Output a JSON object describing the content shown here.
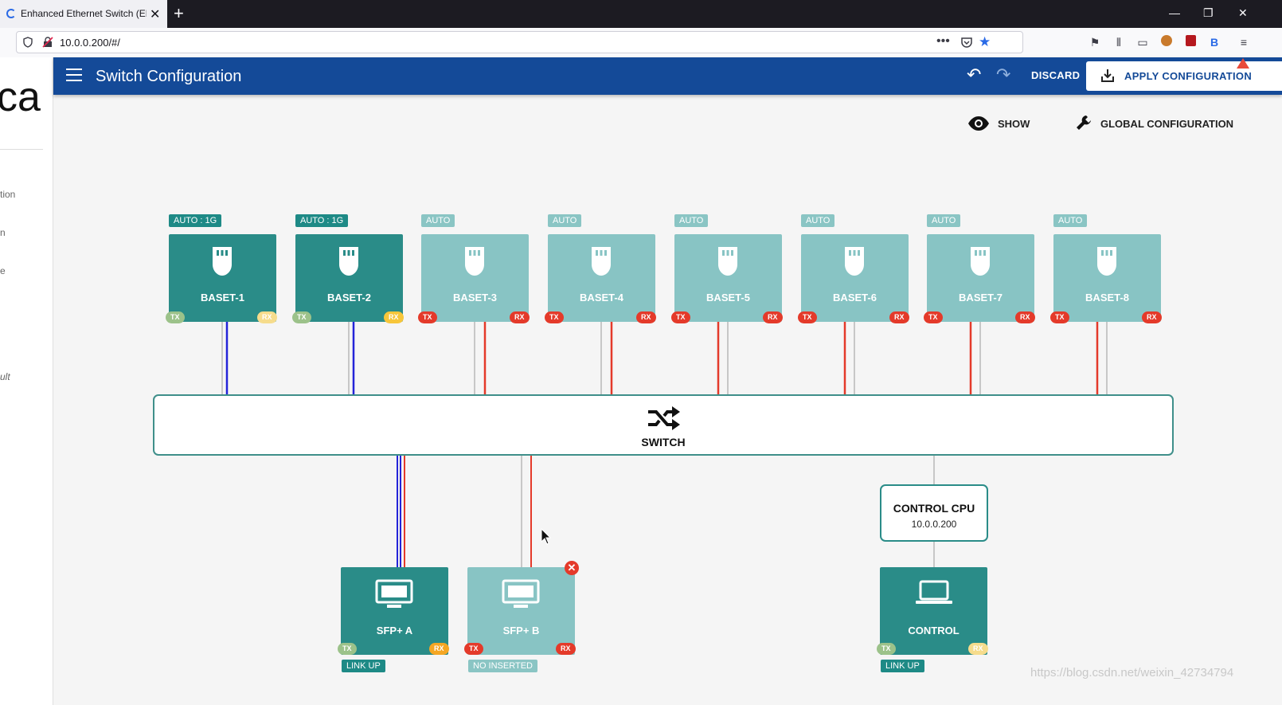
{
  "browser": {
    "tab_title": "Enhanced Ethernet Switch (EES",
    "url": "10.0.0.200/#/"
  },
  "sidebar": {
    "logo_text": "ca",
    "items": [
      "tion",
      "n",
      "e",
      "ult"
    ]
  },
  "appbar": {
    "title": "Switch Configuration",
    "discard_label": "DISCARD",
    "apply_label": "APPLY CONFIGURATION"
  },
  "toolbar": {
    "show_label": "SHOW",
    "global_label": "GLOBAL CONFIGURATION"
  },
  "ports": [
    {
      "name": "BASET-1",
      "tag": "AUTO : 1G",
      "active": true,
      "tx": "TX",
      "rx": "RX"
    },
    {
      "name": "BASET-2",
      "tag": "AUTO : 1G",
      "active": true,
      "tx": "TX",
      "rx": "RX"
    },
    {
      "name": "BASET-3",
      "tag": "AUTO",
      "active": false,
      "tx": "TX",
      "rx": "RX"
    },
    {
      "name": "BASET-4",
      "tag": "AUTO",
      "active": false,
      "tx": "TX",
      "rx": "RX"
    },
    {
      "name": "BASET-5",
      "tag": "AUTO",
      "active": false,
      "tx": "TX",
      "rx": "RX"
    },
    {
      "name": "BASET-6",
      "tag": "AUTO",
      "active": false,
      "tx": "TX",
      "rx": "RX"
    },
    {
      "name": "BASET-7",
      "tag": "AUTO",
      "active": false,
      "tx": "TX",
      "rx": "RX"
    },
    {
      "name": "BASET-8",
      "tag": "AUTO",
      "active": false,
      "tx": "TX",
      "rx": "RX"
    }
  ],
  "switch": {
    "label": "SWITCH"
  },
  "sfp": [
    {
      "name": "SFP+ A",
      "status": "LINK UP",
      "active": true,
      "tx": "TX",
      "rx": "RX"
    },
    {
      "name": "SFP+ B",
      "status": "NO INSERTED",
      "active": false,
      "tx": "TX",
      "rx": "RX"
    }
  ],
  "cpu": {
    "label": "CONTROL CPU",
    "ip": "10.0.0.200"
  },
  "control": {
    "name": "CONTROL",
    "status": "LINK UP",
    "tx": "TX",
    "rx": "RX"
  },
  "watermark": "https://blog.csdn.net/weixin_42734794",
  "colors": {
    "appbar": "#144a98",
    "port_active": "#2a8c88",
    "port_inactive": "#88c4c4",
    "link_blue": "#2323d8",
    "link_red": "#e43a2a"
  }
}
